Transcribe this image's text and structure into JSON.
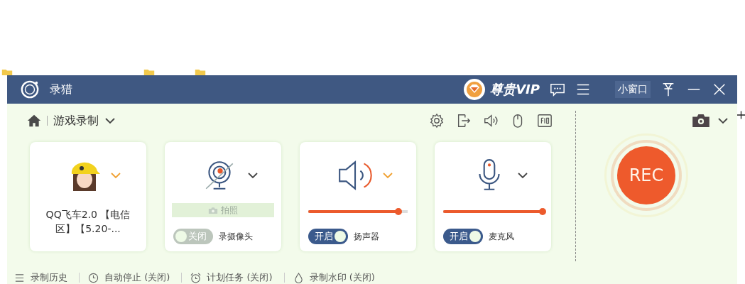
{
  "window": {
    "title": "录猎",
    "vip": "尊贵VIP",
    "mini_window": "小窗口"
  },
  "mode": {
    "label": "游戏录制"
  },
  "sources": [
    {
      "kind": "game",
      "name": "QQ飞车2.0 【电信区】【5.20-..."
    },
    {
      "kind": "camera",
      "snapshot": "拍照",
      "toggle": "关闭",
      "on": false,
      "label": "录摄像头"
    },
    {
      "kind": "speaker",
      "level": 0.91,
      "toggle": "开启",
      "on": true,
      "label": "扬声器"
    },
    {
      "kind": "mic",
      "level": 1.0,
      "toggle": "开启",
      "on": true,
      "label": "麦克风"
    }
  ],
  "rec_button": "REC",
  "bottom_bar": [
    {
      "label": "录制历史"
    },
    {
      "label": "自动停止 (关闭)"
    },
    {
      "label": "计划任务 (关闭)"
    },
    {
      "label": "录制水印 (关闭)"
    }
  ]
}
